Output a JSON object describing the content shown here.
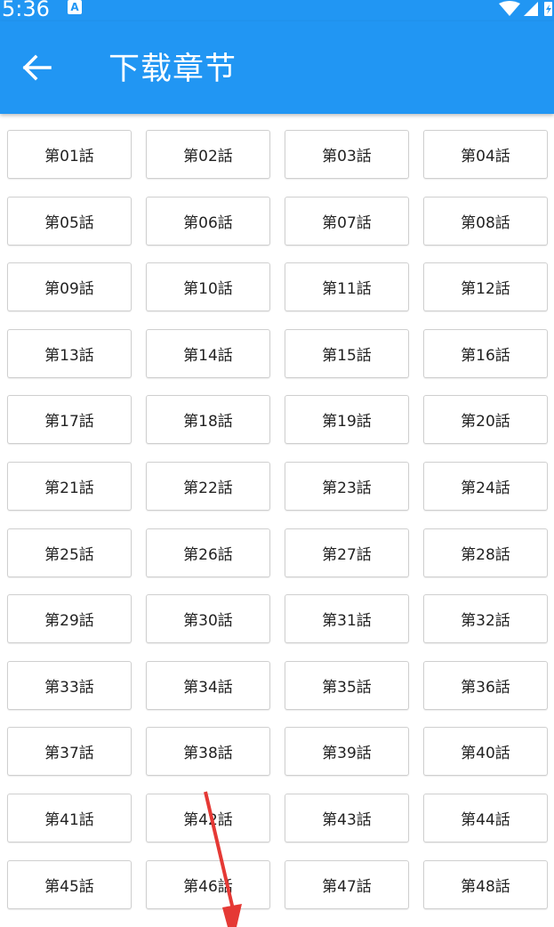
{
  "status_bar": {
    "time": "5:36",
    "app_icon_letter": "A",
    "icons": [
      "wifi-icon",
      "cell-signal-icon",
      "battery-charging-icon"
    ]
  },
  "app_bar": {
    "back_icon": "arrow-left-icon",
    "title": "下载章节",
    "background_color": "#2196f3"
  },
  "chapters": [
    "第01話",
    "第02話",
    "第03話",
    "第04話",
    "第05話",
    "第06話",
    "第07話",
    "第08話",
    "第09話",
    "第10話",
    "第11話",
    "第12話",
    "第13話",
    "第14話",
    "第15話",
    "第16話",
    "第17話",
    "第18話",
    "第19話",
    "第20話",
    "第21話",
    "第22話",
    "第23話",
    "第24話",
    "第25話",
    "第26話",
    "第27話",
    "第28話",
    "第29話",
    "第30話",
    "第31話",
    "第32話",
    "第33話",
    "第34話",
    "第35話",
    "第36話",
    "第37話",
    "第38話",
    "第39話",
    "第40話",
    "第41話",
    "第42話",
    "第43話",
    "第44話",
    "第45話",
    "第46話",
    "第47話",
    "第48話"
  ],
  "annotation": {
    "arrow_color": "#e53935",
    "arrow_icon": "pointer-arrow-icon"
  }
}
